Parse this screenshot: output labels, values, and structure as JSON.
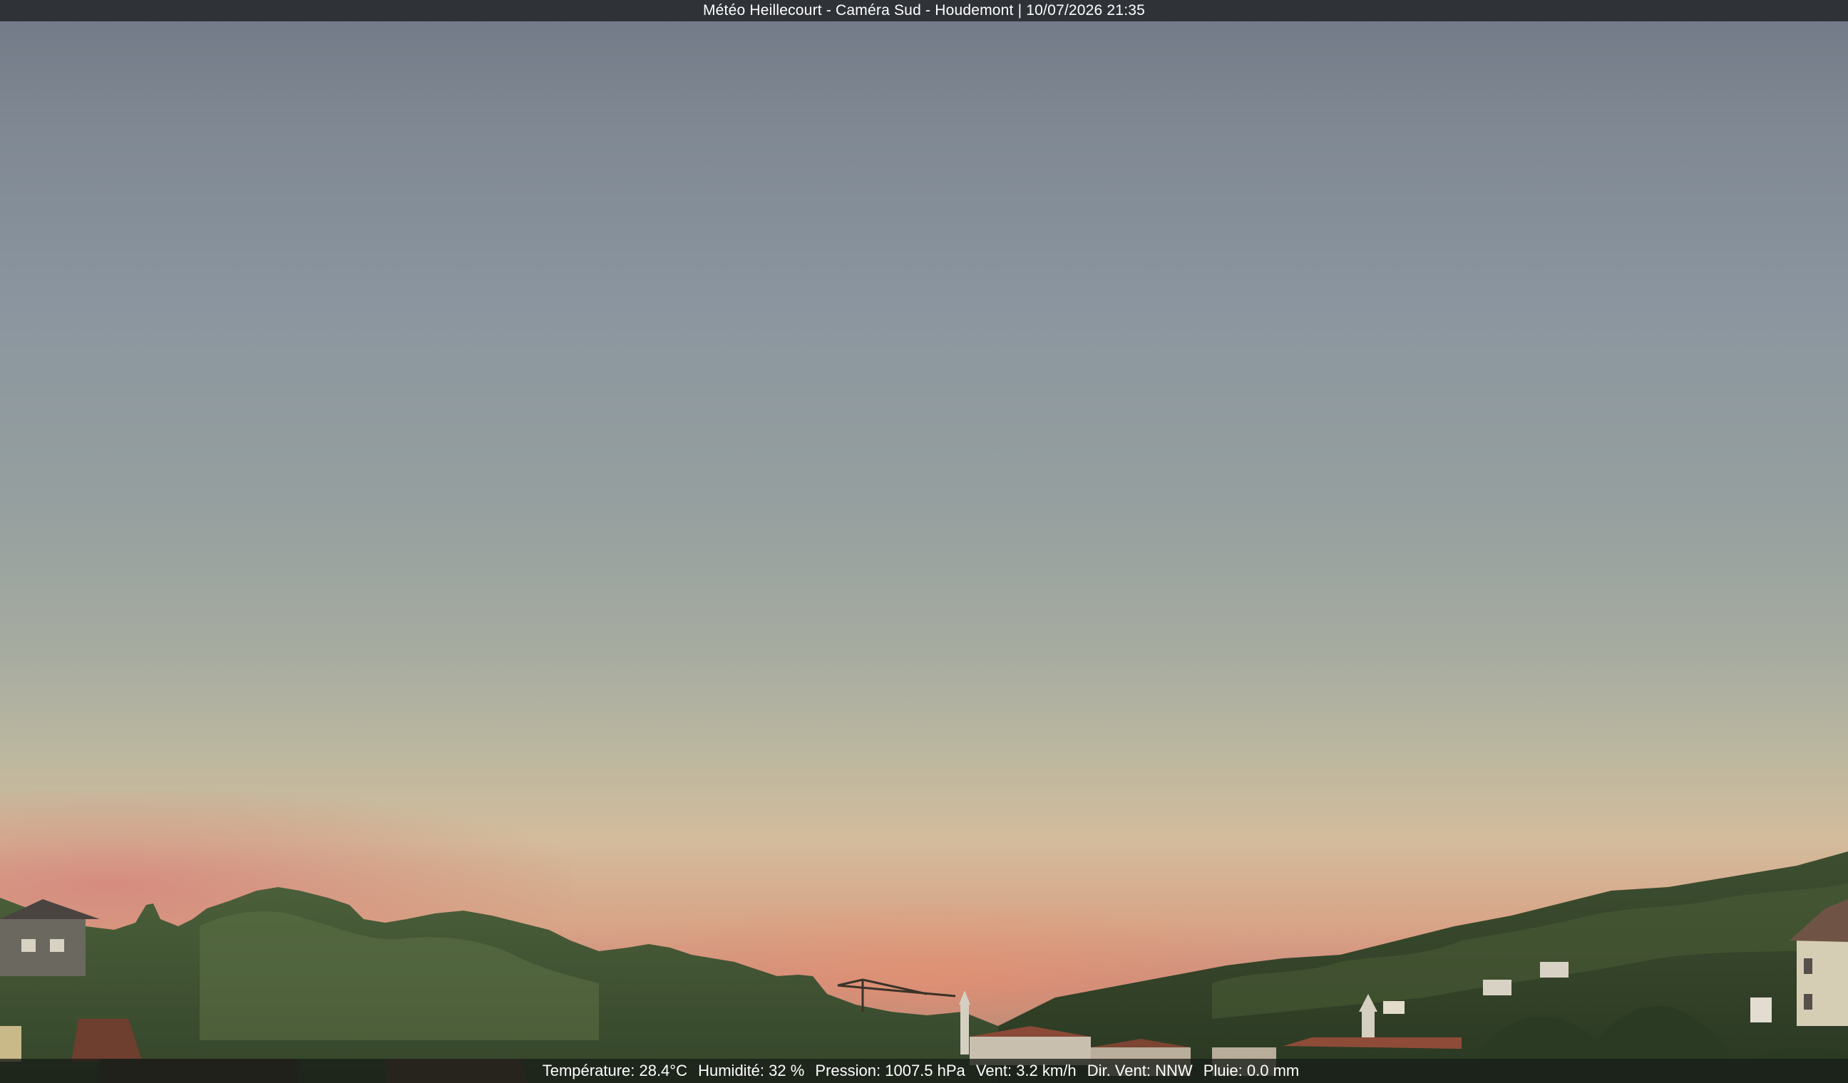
{
  "overlay": {
    "title": "Météo Heillecourt - Caméra Sud - Houdemont | 10/07/2026 21:35"
  },
  "weather": {
    "temperature": "Température: 28.4°C",
    "humidity": "Humidité: 32 %",
    "pressure": "Pression: 1007.5 hPa",
    "wind": "Vent: 3.2 km/h",
    "wind_direction": "Dir. Vent: NNW",
    "rain": "Pluie: 0.0 mm"
  },
  "colors": {
    "title_bar": "#2f3338",
    "sky_top": "#707985",
    "sunset_glow": "#e8926e",
    "trees": "#3c5230"
  }
}
